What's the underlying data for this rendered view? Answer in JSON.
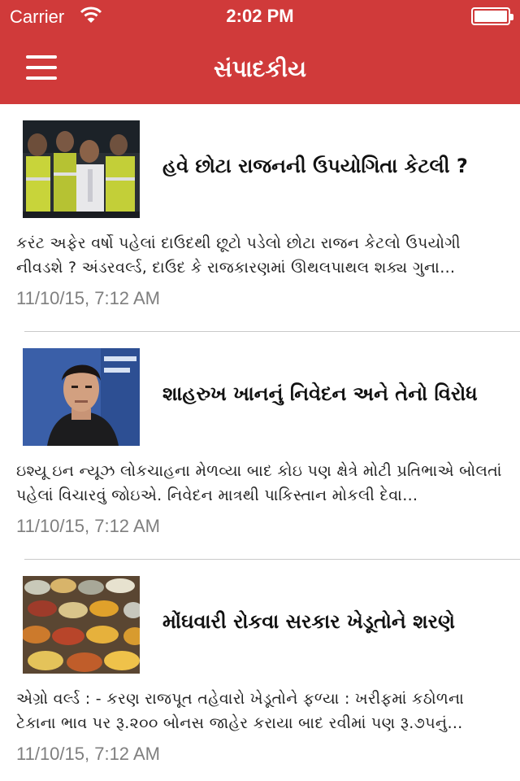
{
  "status_bar": {
    "carrier": "Carrier",
    "time": "2:02 PM"
  },
  "nav": {
    "title": "સંપાદકીય"
  },
  "articles": [
    {
      "headline": "હવે છોટા રાજનની ઉપયોગિતા કેટલી ?",
      "summary": "કરંટ અફેર  વર્ષો પહેલાં દાઉદથી છૂટો પડેલો છોટા રાજન કેટલો ઉપયોગી નીવડશે ? અંડરવર્લ્ડ, દાઉદ કે રાજકારણમાં ઊથલપાથલ શક્ય  ગુના…",
      "date": "11/10/15, 7:12 AM"
    },
    {
      "headline": "શાહરુખ ખાનનું નિવેદન અને તેનો વિરોધ",
      "summary": "ઇશ્યૂ ઇન ન્યૂઝ  લોકચાહના મેળવ્યા બાદ કોઇ પણ ક્ષેત્રે મોટી પ્રતિભાએ બોલતાં પહેલાં વિચારવું જોઇએ. નિવેદન માત્રથી પાકિસ્તાન મોકલી દેવા…",
      "date": "11/10/15, 7:12 AM"
    },
    {
      "headline": "મોંઘવારી રોકવા સરકાર ખેડૂતોને શરણે",
      "summary": "એગ્રો વર્લ્ડ : - કરણ રાજપૂત  તહેવારો ખેડૂતોને ફળ્યા : ખરીફમાં કઠોળના ટેકાના ભાવ પર રૂ.૨૦૦ બોનસ જાહેર કરાયા બાદ રવીમાં પણ રૂ.૭૫નું…",
      "date": "11/10/15, 7:12 AM"
    }
  ],
  "colors": {
    "header": "#d03a3a",
    "date": "#7f7f7f",
    "divider": "#c9c9c9"
  }
}
